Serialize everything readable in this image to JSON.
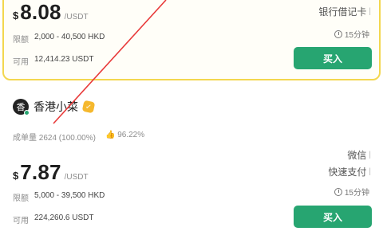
{
  "offers": [
    {
      "currency_symbol": "$",
      "price": "8.08",
      "unit": "/USDT",
      "limit_label": "限额",
      "limit_value": "2,000 - 40,500 HKD",
      "available_label": "可用",
      "available_value": "12,414.23 USDT",
      "payments": [
        "银行借记卡"
      ],
      "time_limit": "15分钟",
      "buy_label": "买入"
    },
    {
      "merchant_avatar_char": "香",
      "merchant_name": "香港小菜",
      "orders_label": "成单量",
      "orders_value": "2624 (100.00%)",
      "rating_value": "96.22%",
      "currency_symbol": "$",
      "price": "7.87",
      "unit": "/USDT",
      "limit_label": "限额",
      "limit_value": "5,000 - 39,500 HKD",
      "available_label": "可用",
      "available_value": "224,260.6 USDT",
      "payments": [
        "微信",
        "快速支付"
      ],
      "time_limit": "15分钟",
      "buy_label": "买入"
    }
  ],
  "colors": {
    "buy_button": "#27a571",
    "highlight_border": "#f3d74e",
    "annotation": "#e83a3a"
  }
}
